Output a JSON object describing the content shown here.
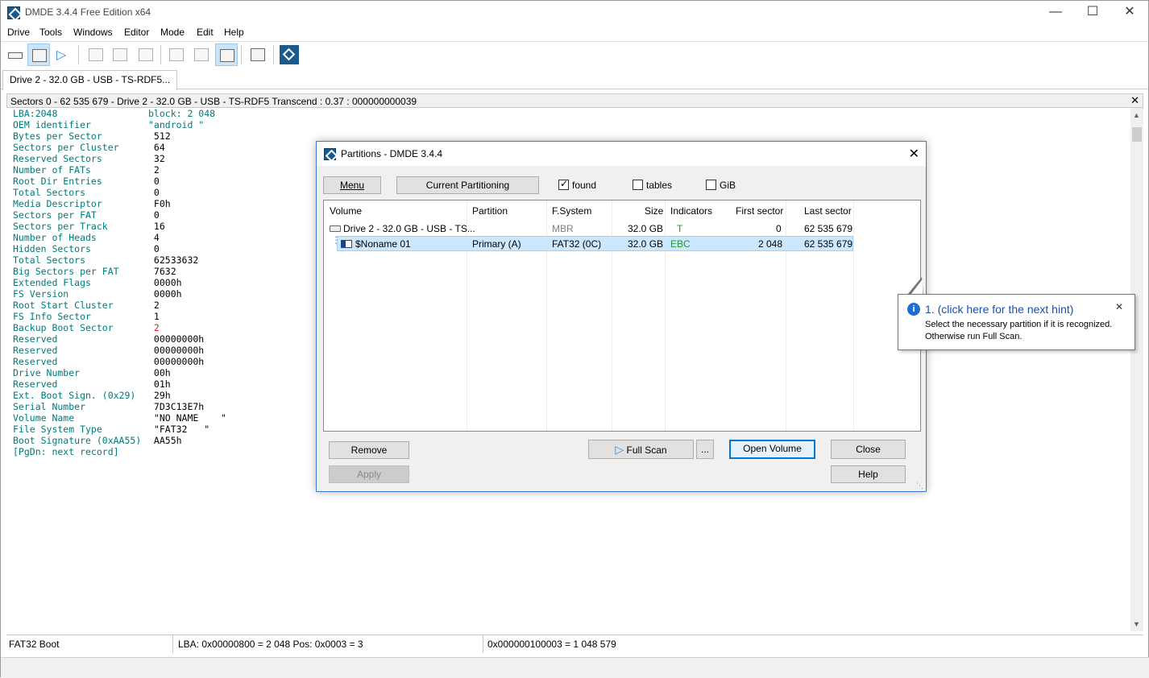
{
  "window": {
    "title": "DMDE 3.4.4 Free Edition x64"
  },
  "menu": [
    "Drive",
    "Tools",
    "Windows",
    "Editor",
    "Mode",
    "Edit",
    "Help"
  ],
  "tab": {
    "label": "Drive 2 - 32.0 GB - USB - TS-RDF5..."
  },
  "sector_header": "Sectors 0 - 62 535 679 - Drive 2 - 32.0 GB - USB - TS-RDF5  Transcend : 0.37 : 000000000039",
  "boot_fields": [
    {
      "label": "LBA:2048",
      "value": "block: 2 048",
      "style": "teal"
    },
    {
      "label": "OEM identifier",
      "value": "\"android \"",
      "style": "teal"
    },
    {
      "label": "Bytes per Sector",
      "value": " 512",
      "style": ""
    },
    {
      "label": "Sectors per Cluster",
      "value": " 64",
      "style": ""
    },
    {
      "label": "Reserved Sectors",
      "value": " 32",
      "style": ""
    },
    {
      "label": "Number of FATs",
      "value": " 2",
      "style": ""
    },
    {
      "label": "Root Dir Entries",
      "value": " 0",
      "style": ""
    },
    {
      "label": "Total Sectors",
      "value": " 0",
      "style": ""
    },
    {
      "label": "Media Descriptor",
      "value": " F0h",
      "style": ""
    },
    {
      "label": "Sectors per FAT",
      "value": " 0",
      "style": ""
    },
    {
      "label": "Sectors per Track",
      "value": " 16",
      "style": ""
    },
    {
      "label": "Number of Heads",
      "value": " 4",
      "style": ""
    },
    {
      "label": "Hidden Sectors",
      "value": " 0",
      "style": ""
    },
    {
      "label": "Total Sectors",
      "value": " 62533632",
      "style": ""
    },
    {
      "label": "Big Sectors per FAT",
      "value": " 7632",
      "style": ""
    },
    {
      "label": "Extended Flags",
      "value": " 0000h",
      "style": ""
    },
    {
      "label": "FS Version",
      "value": " 0000h",
      "style": ""
    },
    {
      "label": "Root Start Cluster",
      "value": " 2",
      "style": ""
    },
    {
      "label": "FS Info Sector",
      "value": " 1",
      "style": ""
    },
    {
      "label": "Backup Boot Sector",
      "value": " 2",
      "style": "red"
    },
    {
      "label": "Reserved",
      "value": " 00000000h",
      "style": ""
    },
    {
      "label": "Reserved",
      "value": " 00000000h",
      "style": ""
    },
    {
      "label": "Reserved",
      "value": " 00000000h",
      "style": ""
    },
    {
      "label": "Drive Number",
      "value": " 00h",
      "style": ""
    },
    {
      "label": "Reserved",
      "value": " 01h",
      "style": ""
    },
    {
      "label": "Ext. Boot Sign. (0x29)",
      "value": " 29h",
      "style": ""
    },
    {
      "label": "Serial Number",
      "value": " 7D3C13E7h",
      "style": ""
    },
    {
      "label": "Volume Name",
      "value": " \"NO NAME    \"",
      "style": ""
    },
    {
      "label": "File System Type",
      "value": " \"FAT32   \"",
      "style": ""
    },
    {
      "label": "Boot Signature (0xAA55)",
      "value": " AA55h",
      "style": ""
    },
    {
      "label": "[PgDn: next record]",
      "value": "",
      "style": "teal"
    }
  ],
  "status": {
    "left": "FAT32 Boot",
    "mid": "LBA: 0x00000800 = 2 048  Pos: 0x0003 = 3",
    "right": "0x000000100003 = 1 048 579"
  },
  "dialog": {
    "title": "Partitions - DMDE 3.4.4",
    "menu_btn": "Menu",
    "current_btn": "Current Partitioning",
    "checks": [
      {
        "label": "found",
        "checked": true
      },
      {
        "label": "tables",
        "checked": false
      },
      {
        "label": "GiB",
        "checked": false
      }
    ],
    "columns": [
      "Volume",
      "Partition",
      "F.System",
      "Size",
      "Indicators",
      "First sector",
      "Last sector"
    ],
    "rows": [
      {
        "volume": "Drive 2 - 32.0 GB - USB - TS...",
        "partition": "",
        "fs": "MBR",
        "size": "32.0 GB",
        "ind": "T",
        "first": "0",
        "last": "62 535 679"
      },
      {
        "volume": "$Noname 01",
        "partition": "Primary (A)",
        "fs": "FAT32 (0C)",
        "size": "32.0 GB",
        "ind": "EBC",
        "first": "2 048",
        "last": "62 535 679"
      }
    ],
    "buttons": {
      "remove": "Remove",
      "apply": "Apply",
      "full_scan": "Full Scan",
      "more": "...",
      "open_volume": "Open Volume",
      "close": "Close",
      "help": "Help"
    }
  },
  "hint": {
    "title": "1. (click here for the next hint)",
    "line1": "Select the necessary partition if it is recognized.",
    "line2": "Otherwise run Full Scan."
  },
  "colors": {
    "accent": "#0078d7",
    "teal": "#007a7a",
    "indicator_green": "#1aa01a",
    "hint_blue": "#1f4eaa"
  }
}
